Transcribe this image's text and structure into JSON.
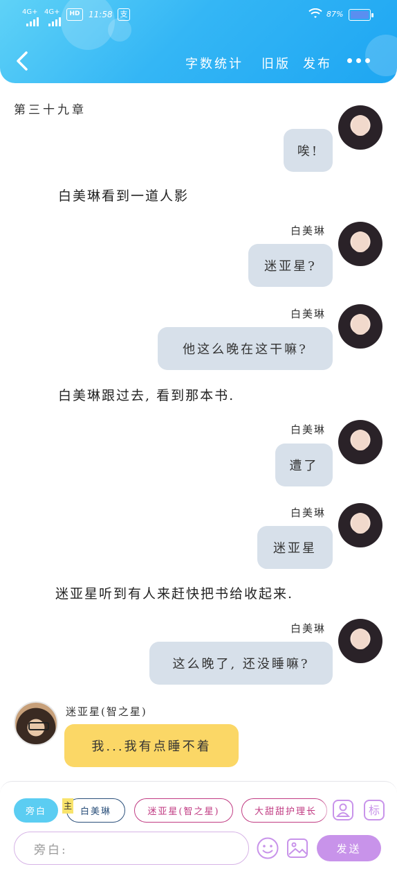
{
  "statusbar": {
    "network1": "4G+",
    "network2": "4G+",
    "hd": "HD",
    "time": "11:58",
    "pay_icon": "支",
    "battery_pct": "87%"
  },
  "header": {
    "word_count": "字数统计",
    "old_version": "旧版",
    "publish": "发布",
    "colors": {
      "gradient_start": "#5fd2f7",
      "gradient_end": "#1ea6f2"
    }
  },
  "chapter_title": "第三十九章",
  "messages": [
    {
      "type": "bubble",
      "side": "right",
      "text": "唉!"
    },
    {
      "type": "narration",
      "text": "白美琳看到一道人影"
    },
    {
      "type": "bubble",
      "side": "right",
      "sender": "白美琳",
      "text": "迷亚星?"
    },
    {
      "type": "bubble",
      "side": "right",
      "sender": "白美琳",
      "text": "他这么晚在这干嘛?"
    },
    {
      "type": "narration",
      "text": "白美琳跟过去, 看到那本书."
    },
    {
      "type": "bubble",
      "side": "right",
      "sender": "白美琳",
      "text": "遭了"
    },
    {
      "type": "bubble",
      "side": "right",
      "sender": "白美琳",
      "text": "迷亚星"
    },
    {
      "type": "narration",
      "text": "迷亚星听到有人来赶快把书给收起来."
    },
    {
      "type": "bubble",
      "side": "right",
      "sender": "白美琳",
      "text": "这么晚了, 还没睡嘛?"
    },
    {
      "type": "bubble",
      "side": "left",
      "sender": "迷亚星(智之星)",
      "text": "我...我有点睡不着"
    }
  ],
  "toolbar": {
    "narration_chip": "旁白",
    "main_tag": "主",
    "characters": [
      "白美琳",
      "迷亚星(智之星)",
      "大甜甜护理长"
    ],
    "input_placeholder": "旁白:",
    "send": "发送",
    "icons": [
      "person-card-icon",
      "tag-icon",
      "emoji-icon",
      "image-icon"
    ],
    "colors": {
      "accent": "#5bcdf2",
      "send": "#c893ea",
      "pink_border": "#c03a82"
    }
  }
}
